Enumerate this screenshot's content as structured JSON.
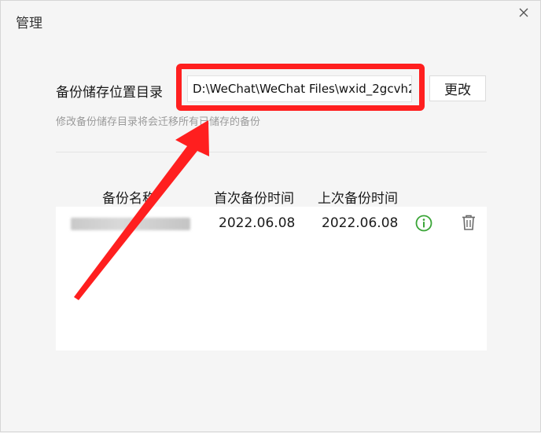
{
  "window": {
    "title": "管理",
    "close_icon": "close-icon"
  },
  "backup_dir": {
    "label": "备份储存位置目录",
    "path_value": "D:\\WeChat\\WeChat Files\\wxid_2gcvh2",
    "change_button": "更改",
    "hint": "修改备份储存目录将会迁移所有已储存的备份"
  },
  "table": {
    "headers": {
      "name": "备份名称",
      "first_backup": "首次备份时间",
      "last_backup": "上次备份时间"
    },
    "rows": [
      {
        "name": "",
        "first_backup": "2022.06.08",
        "last_backup": "2022.06.08",
        "info_icon": "info-icon",
        "delete_icon": "trash-icon"
      }
    ]
  },
  "colors": {
    "annotation_red": "#ff1f1f",
    "info_green": "#3aa537",
    "background": "#f5f5f5"
  }
}
